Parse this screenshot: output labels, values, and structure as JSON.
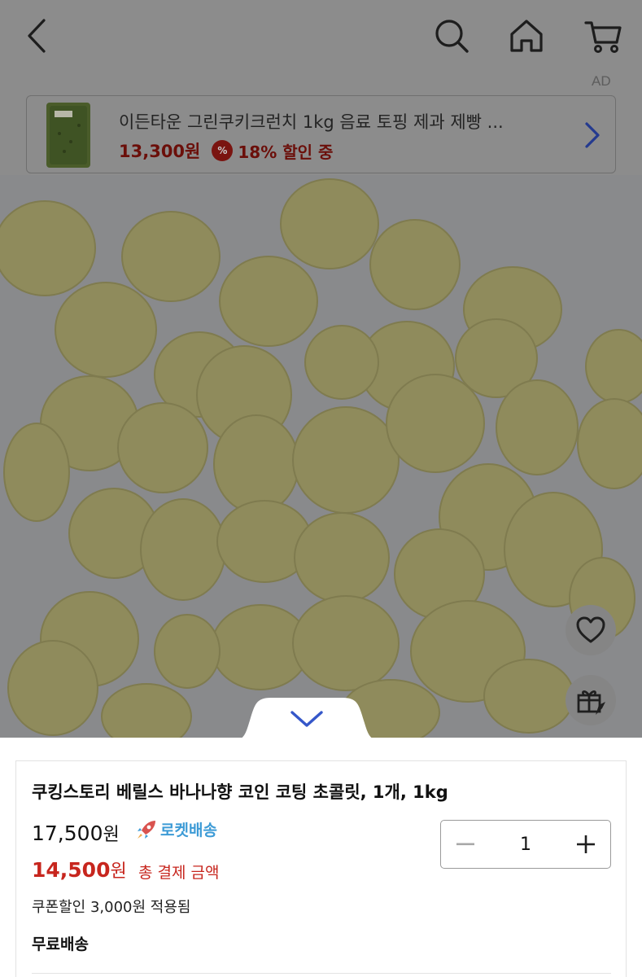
{
  "header": {
    "back_icon": "back-chevron-icon",
    "search_icon": "search-icon",
    "home_icon": "home-icon",
    "cart_icon": "cart-icon"
  },
  "ad": {
    "label": "AD",
    "title": "이든타운 그린쿠키크런치 1kg 음료 토핑 제과 제빵 ...",
    "price": "13,300원",
    "discount": "18% 할인 중",
    "discount_badge": "%"
  },
  "product": {
    "title": "쿠킹스토리 베릴스 바나나향 코인 코팅 초콜릿, 1개, 1kg",
    "original_price_number": "17,500",
    "original_price_unit": "원",
    "delivery_badge": "로켓배송",
    "sale_price_number": "14,500",
    "sale_price_unit": "원",
    "total_label": "총 결제 금액",
    "coupon_text": "쿠폰할인 3,000원 적용됨",
    "shipping": "무료배송",
    "quantity": "1"
  },
  "colors": {
    "sale_red": "#c7261e",
    "rocket_blue": "#3d9bd6",
    "dim_overlay": "#8c8c8c",
    "collapse_arrow": "#3557c9"
  }
}
